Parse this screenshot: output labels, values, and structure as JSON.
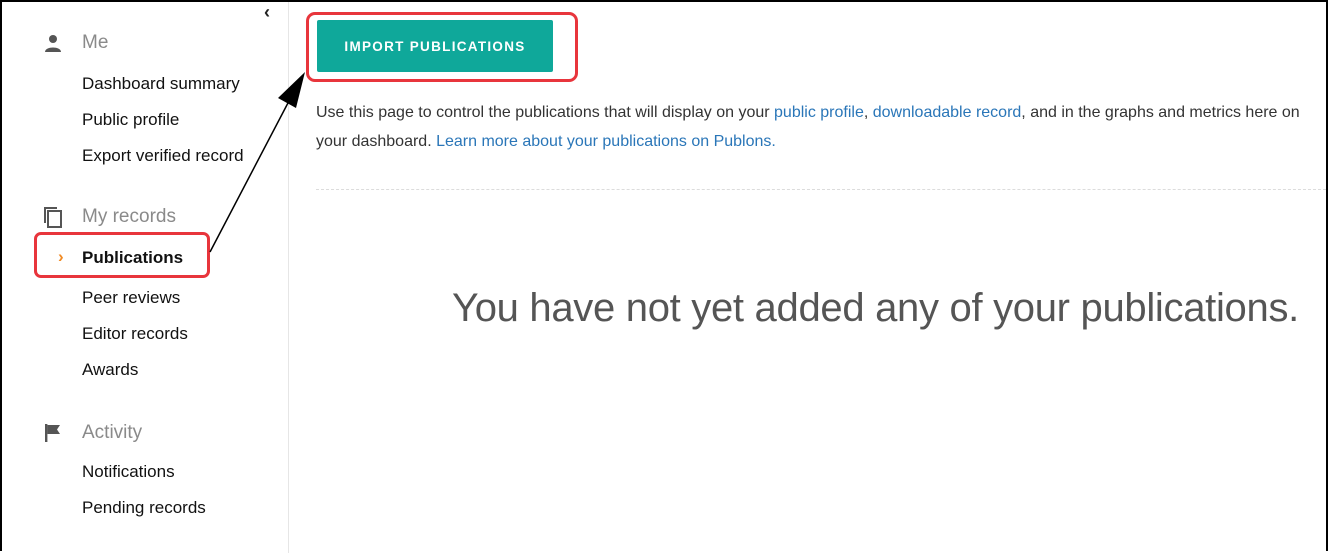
{
  "sidebar": {
    "collapse_icon": "chevron-left-icon",
    "me": {
      "label": "Me",
      "icon": "person-icon",
      "items": [
        "Dashboard summary",
        "Public profile",
        "Export verified record"
      ]
    },
    "records": {
      "label": "My records",
      "icon": "copy-icon",
      "items": [
        "Publications",
        "Peer reviews",
        "Editor records",
        "Awards"
      ],
      "active": "Publications"
    },
    "activity": {
      "label": "Activity",
      "icon": "flag-icon",
      "items": [
        "Notifications",
        "Pending records"
      ]
    }
  },
  "main": {
    "import_button": "IMPORT PUBLICATIONS",
    "intro": {
      "part1": "Use this page to control the publications that will display on your ",
      "link_public_profile": "public profile",
      "sep1": ", ",
      "link_downloadable_record": "downloadable record",
      "part2": ", and in the graphs and metrics here on your dashboard. ",
      "link_learn_more": "Learn more about your publications on Publons."
    },
    "empty_message": "You have not yet added any of your publications."
  },
  "colors": {
    "accent": "#0fa89a",
    "highlight": "#e8353c",
    "link": "#2a76b8",
    "active_chevron": "#f08a24"
  }
}
